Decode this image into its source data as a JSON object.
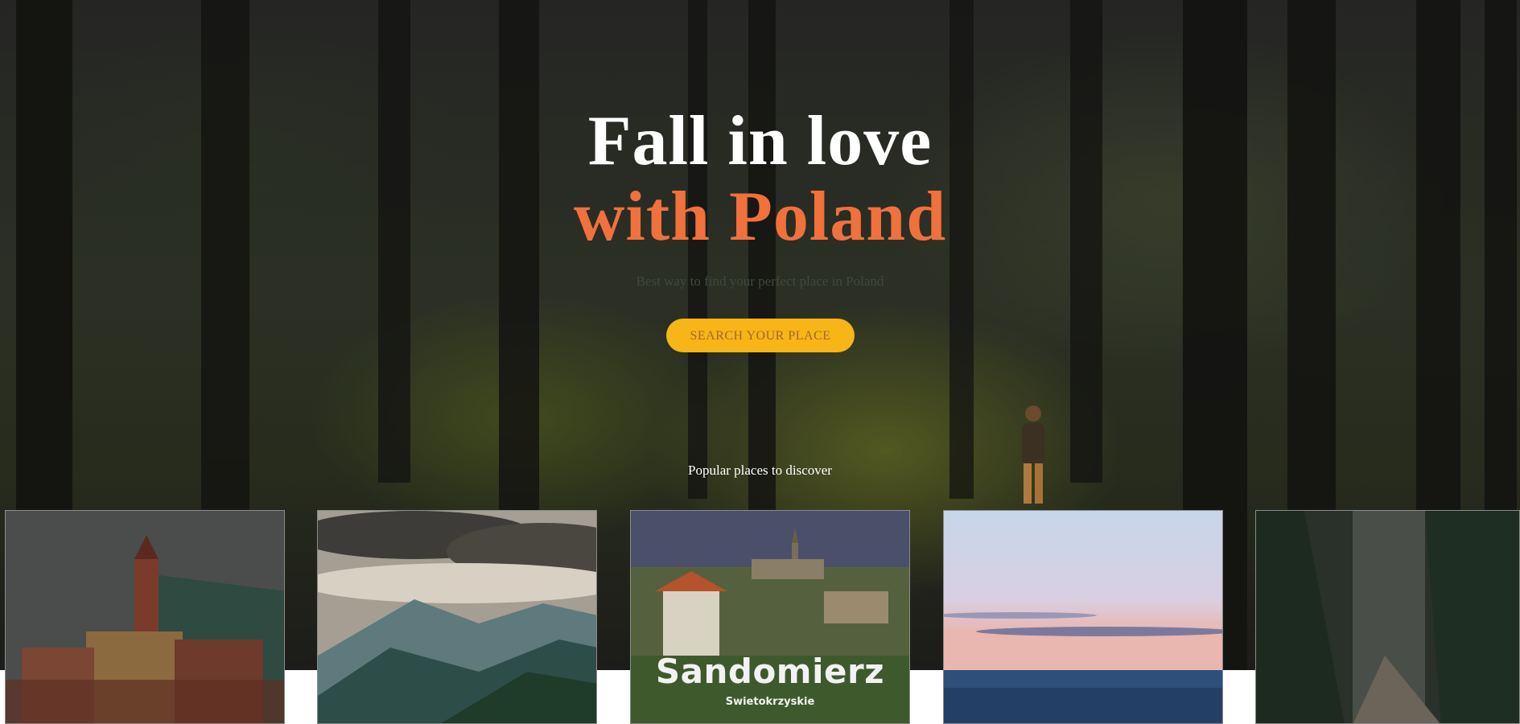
{
  "hero": {
    "title_line1": "Fall in love",
    "title_line2": "with Poland",
    "subtitle": "Best way to find your perfect place in Poland",
    "cta_label": "SEARCH YOUR PLACE",
    "accent_color": "#f0713c",
    "cta_color": "#f8b517"
  },
  "popular": {
    "heading": "Popular places to discover",
    "cards": [
      {
        "title": "",
        "subtitle": "",
        "scene": "old-town"
      },
      {
        "title": "",
        "subtitle": "",
        "scene": "mountains"
      },
      {
        "title": "Sandomierz",
        "subtitle": "Swietokrzyskie",
        "scene": "castle-town"
      },
      {
        "title": "",
        "subtitle": "",
        "scene": "sea"
      },
      {
        "title": "",
        "subtitle": "",
        "scene": "forest"
      }
    ]
  }
}
